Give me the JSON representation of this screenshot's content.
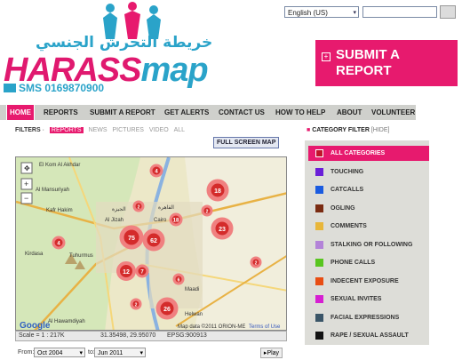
{
  "header": {
    "language": "English (US)",
    "logo_arabic": "خريطة التحرش الجنسي",
    "logo_main_a": "HARASS",
    "logo_main_b": "map",
    "sms": "SMS 0169870900",
    "submit_label": "SUBMIT A REPORT",
    "submit_line1": "SUBMIT A",
    "submit_line2": "REPORT"
  },
  "nav": [
    "HOME",
    "REPORTS",
    "SUBMIT A REPORT",
    "GET ALERTS",
    "CONTACT US",
    "HOW TO HELP",
    "ABOUT",
    "VOLUNTEER"
  ],
  "filters": {
    "label": "FILTERS",
    "items": [
      "REPORTS",
      "NEWS",
      "PICTURES",
      "VIDEO",
      "ALL"
    ],
    "fullscreen": "FULL SCREEN MAP"
  },
  "map": {
    "labels": [
      "El Kom Al Akhdar",
      "Al Mansuriyah",
      "Kafr Hakim",
      "Kirdasa",
      "Al Hawamdiyah",
      "Al Jizah",
      "Cairo",
      "القاهرة",
      "الجيزة",
      "Tuhurmus",
      "Maadi",
      "Helwan"
    ],
    "clusters": [
      "4",
      "75",
      "62",
      "18",
      "23",
      "12",
      "26",
      "7",
      "4",
      "2",
      "2",
      "6",
      "2",
      "18",
      "2"
    ],
    "copyright": "Map data ©2011 ORION-ME",
    "terms": "Terms of Use",
    "google": "Google"
  },
  "scalebar": {
    "scale": "Scale = 1 : 217K",
    "coords": "31.35498, 29.95070",
    "epsg": "EPSG:900913"
  },
  "categories": {
    "title": "CATEGORY FILTER",
    "hide": "[HIDE]",
    "items": [
      {
        "label": "ALL CATEGORIES",
        "color": "#c0142b"
      },
      {
        "label": "TOUCHING",
        "color": "#6a1fd8"
      },
      {
        "label": "CATCALLS",
        "color": "#1a5be0"
      },
      {
        "label": "OGLING",
        "color": "#7a2b12"
      },
      {
        "label": "COMMENTS",
        "color": "#e8b63a"
      },
      {
        "label": "STALKING OR FOLLOWING",
        "color": "#b383d8"
      },
      {
        "label": "PHONE CALLS",
        "color": "#58c51f"
      },
      {
        "label": "INDECENT EXPOSURE",
        "color": "#e84d13"
      },
      {
        "label": "SEXUAL INVITES",
        "color": "#d61fd2"
      },
      {
        "label": "FACIAL EXPRESSIONS",
        "color": "#3a5568"
      },
      {
        "label": "RAPE / SEXUAL ASSAULT",
        "color": "#121212"
      }
    ]
  },
  "timeline": {
    "from_label": "From:",
    "from_value": "Oct 2004",
    "to_label": "to:",
    "to_value": "Jun 2011",
    "play": "Play"
  },
  "colors": {
    "accent": "#e71a6e",
    "brand_blue": "#2aa3c9",
    "cluster": "#d42b2b"
  }
}
